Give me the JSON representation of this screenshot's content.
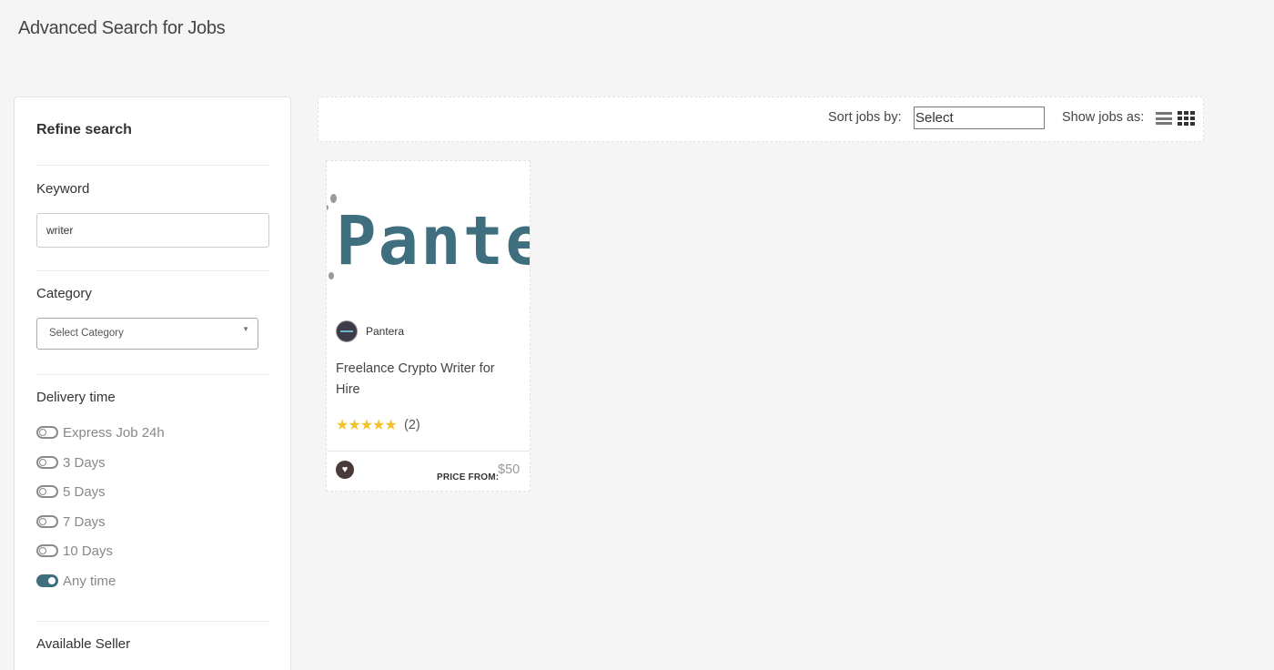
{
  "page": {
    "title": "Advanced Search for Jobs"
  },
  "sidebar": {
    "heading": "Refine search",
    "keyword": {
      "label": "Keyword",
      "value": "writer"
    },
    "category": {
      "label": "Category",
      "placeholder": "Select Category"
    },
    "delivery": {
      "label": "Delivery time",
      "options": [
        {
          "label": "Express Job 24h",
          "selected": false
        },
        {
          "label": "3 Days",
          "selected": false
        },
        {
          "label": "5 Days",
          "selected": false
        },
        {
          "label": "7 Days",
          "selected": false
        },
        {
          "label": "10 Days",
          "selected": false
        },
        {
          "label": "Any time",
          "selected": true
        }
      ]
    },
    "available_seller": {
      "label": "Available Seller"
    }
  },
  "toolbar": {
    "sort_label": "Sort jobs by:",
    "sort_value": "Select",
    "show_label": "Show jobs as:",
    "view_mode": "grid"
  },
  "jobs": [
    {
      "thumbnail_text": "Panter",
      "seller": "Pantera",
      "title": "Freelance Crypto Writer for Hire",
      "rating_stars": 5,
      "rating_count": "(2)",
      "price_label": "PRICE FROM:",
      "price": "$50"
    }
  ],
  "colors": {
    "accent": "#3f6e7e",
    "star": "#f2c12e",
    "background": "#f5f5f5"
  }
}
